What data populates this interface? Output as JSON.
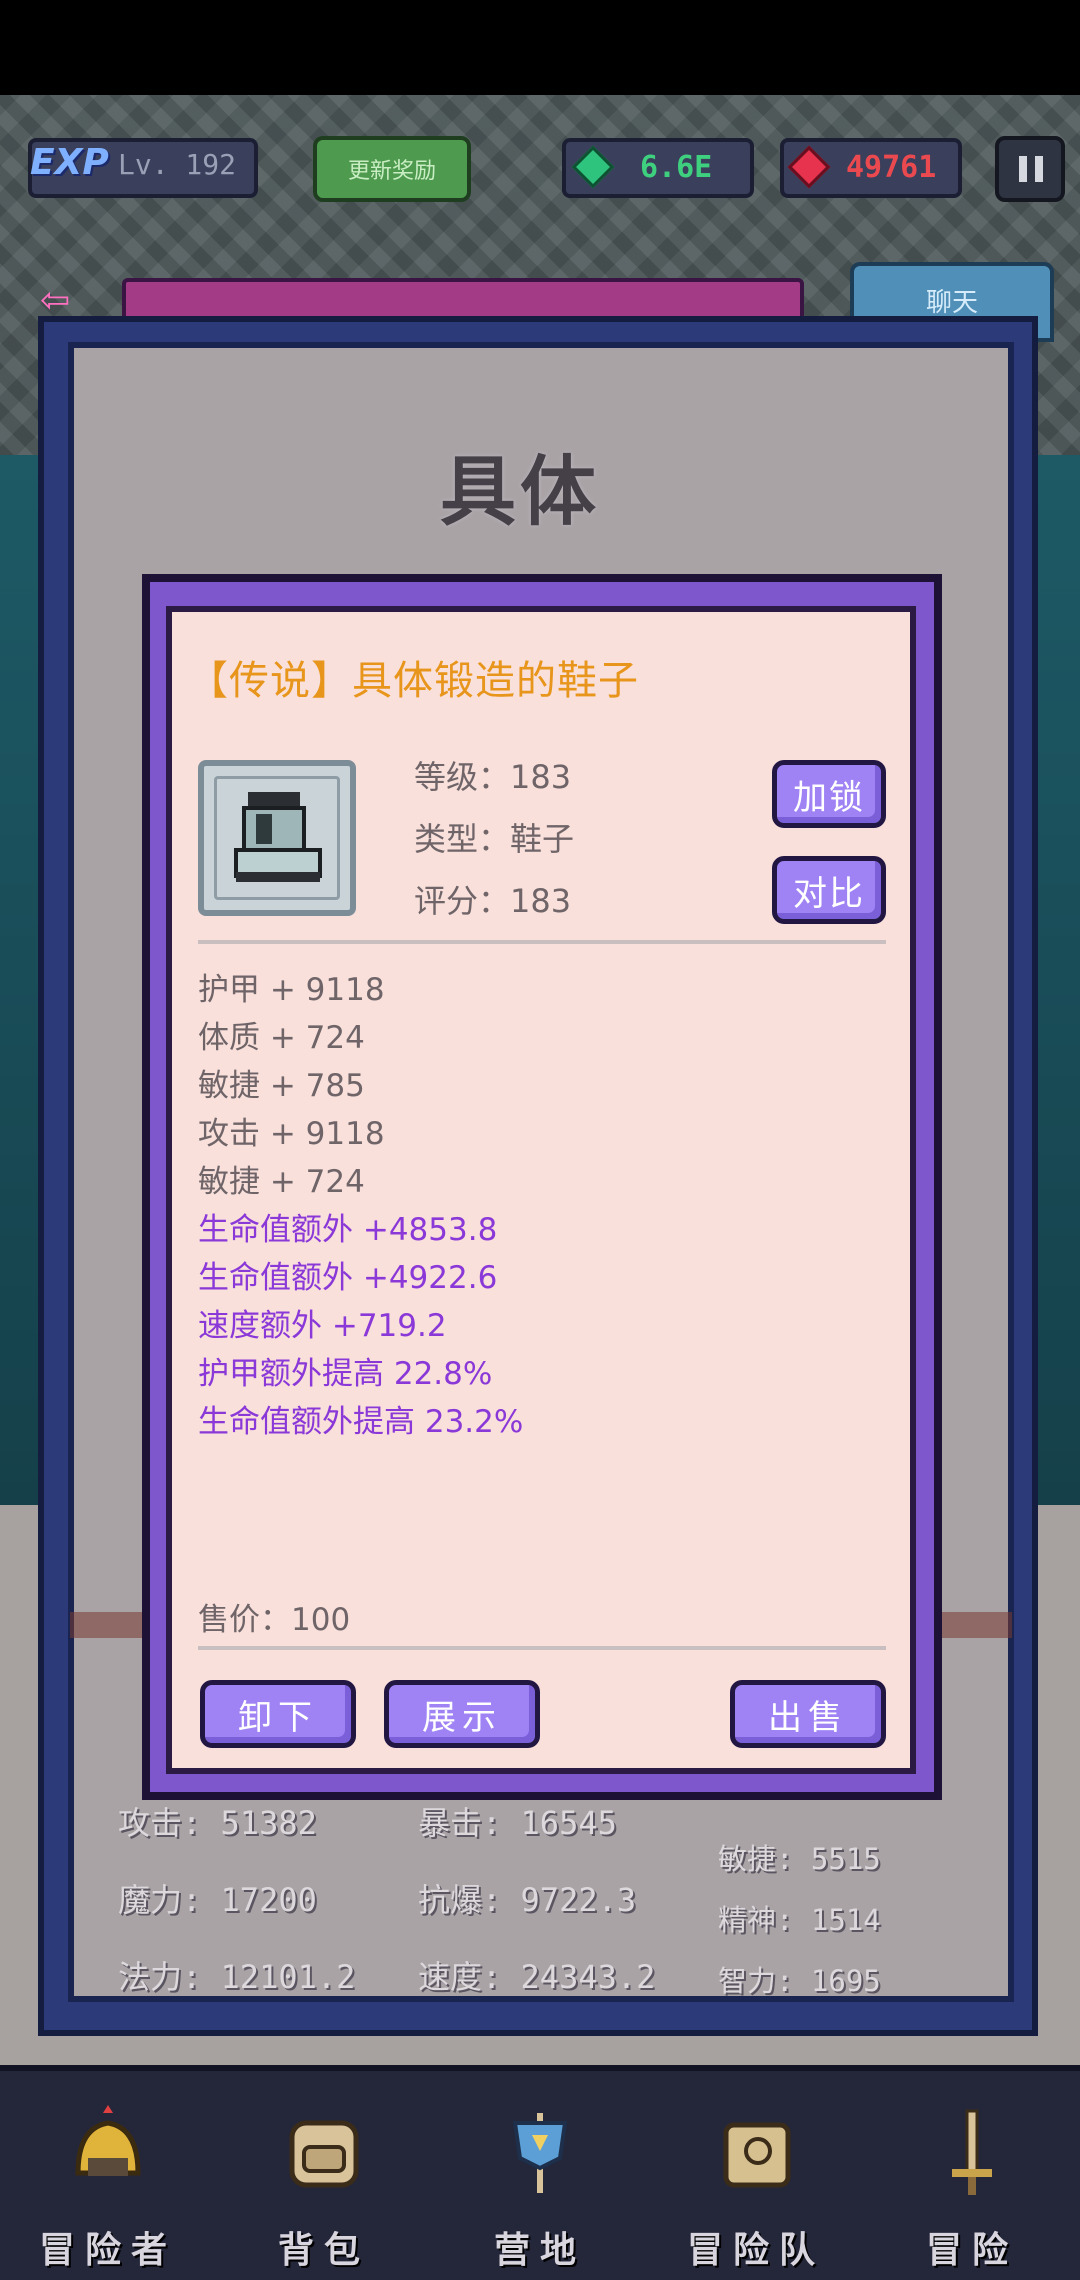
{
  "hud": {
    "exp_badge": "EXP",
    "level": "Lv. 192",
    "reward_button": "更新奖励",
    "gems": "6.6E",
    "rubies": "49761",
    "chat_button": "聊天"
  },
  "panel": {
    "title": "具体"
  },
  "character_stats": [
    {
      "label": "攻击: 51382"
    },
    {
      "label": "暴击: 16545"
    },
    {
      "label": "魔力: 17200"
    },
    {
      "label": "抗爆: 9722.3"
    },
    {
      "label": "法力: 12101.2"
    },
    {
      "label": "速度: 24343.2"
    },
    {
      "label": "敏捷: 5515"
    },
    {
      "label": "精神: 1514"
    },
    {
      "label": "智力: 1695"
    }
  ],
  "item": {
    "title": "【传说】具体锻造的鞋子",
    "icon": "boot-icon",
    "level": "等级：183",
    "type": "类型：鞋子",
    "score": "评分：183",
    "lock_button": "加锁",
    "compare_button": "对比",
    "base_stats": [
      "护甲 + 9118",
      "体质 + 724",
      "敏捷 + 785",
      "攻击 + 9118",
      "敏捷 + 724"
    ],
    "bonus_stats": [
      "生命值额外 +4853.8",
      "生命值额外 +4922.6",
      "速度额外 +719.2",
      "护甲额外提高 22.8%",
      "生命值额外提高 23.2%"
    ],
    "price": "售价：100",
    "unequip_button": "卸下",
    "show_button": "展示",
    "sell_button": "出售"
  },
  "nav": [
    {
      "label": "冒险者",
      "icon": "adventurer-helmet-icon"
    },
    {
      "label": "背包",
      "icon": "backpack-icon"
    },
    {
      "label": "营地",
      "icon": "camp-banner-icon"
    },
    {
      "label": "冒险队",
      "icon": "team-book-icon"
    },
    {
      "label": "冒险",
      "icon": "sword-icon"
    }
  ],
  "colors": {
    "dialog_frame": "#7f57cc",
    "dialog_bg": "#f9e0db",
    "legendary_title": "#e8951c",
    "bonus_stat": "#8a38d8",
    "button": "#9f82f4"
  }
}
